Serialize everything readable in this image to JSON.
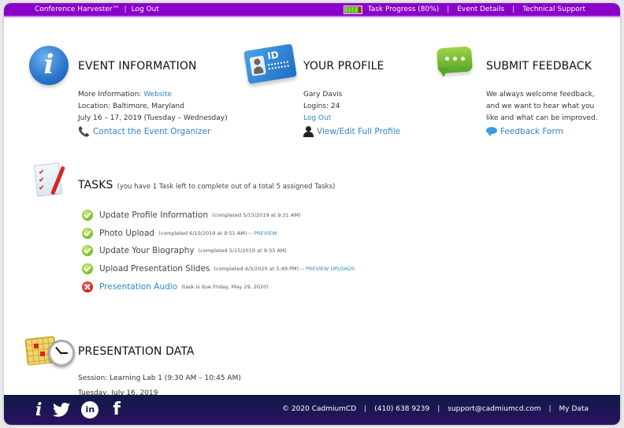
{
  "topbar": {
    "brand": "Conference Harvester™",
    "logout": "Log Out",
    "task_progress_label": "Task Progress (80%)",
    "task_progress_value": 0.8,
    "progress_colors": {
      "complete": "#7ddc1f",
      "incomplete": "#d8141b"
    },
    "event_details": "Event Details",
    "technical_support": "Technical Support"
  },
  "event_info": {
    "title": "EVENT INFORMATION",
    "more_info_label": "More Information:",
    "website_link": "Website",
    "location_label": "Location:",
    "location_value": "Baltimore, Maryland",
    "dates": "July 16 – 17, 2019 (Tuesday – Wednesday)",
    "contact_link": "Contact the Event Organizer",
    "icon": "info-icon"
  },
  "profile": {
    "title": "YOUR PROFILE",
    "name": "Gary Davis",
    "logins_label": "Logins:",
    "logins_value": "24",
    "logout_link": "Log Out",
    "edit_link": "View/Edit Full Profile",
    "badge_text": "ID",
    "icon": "id-card-icon"
  },
  "feedback": {
    "title": "SUBMIT FEEDBACK",
    "lines": [
      "We always welcome feedback,",
      "and we want to hear what you",
      "like and what can be improved."
    ],
    "form_link": "Feedback Form",
    "icon": "chat-bubble-icon"
  },
  "tasks": {
    "title": "TASKS",
    "subtitle": "(you have 1 Task left to complete out of a total 5 assigned Tasks)",
    "items": [
      {
        "name": "Update Profile Information",
        "status": "complete",
        "meta": "(completed 5/15/2019 at 9:31 AM)",
        "action": ""
      },
      {
        "name": "Photo Upload",
        "status": "complete",
        "meta": "(completed 6/10/2019 at 9:51 AM) --",
        "action": "PREVIEW"
      },
      {
        "name": "Update Your Biography",
        "status": "complete",
        "meta": "(completed 5/15/2019 at 9:33 AM)",
        "action": ""
      },
      {
        "name": "Upload Presentation Slides",
        "status": "complete",
        "meta": "(completed 4/3/2020 at 5:49 PM) --",
        "action": "PREVIEW UPLOADS"
      },
      {
        "name": "Presentation Audio",
        "status": "incomplete",
        "meta": "(task is due Friday, May 29, 2020)",
        "action": ""
      }
    ]
  },
  "presentation": {
    "title": "PRESENTATION DATA",
    "session_label": "Session:",
    "session_value": "Learning Lab 1",
    "session_time": "(9:30 AM – 10:45 AM)",
    "date": "Tuesday, July 16, 2019"
  },
  "footer": {
    "copyright": "© 2020 CadmiumCD",
    "phone": "(410) 638 9239",
    "email": "support@cadmiumcd.com",
    "my_data": "My Data",
    "social": [
      "info-icon",
      "twitter-icon",
      "linkedin-icon",
      "facebook-icon"
    ]
  }
}
